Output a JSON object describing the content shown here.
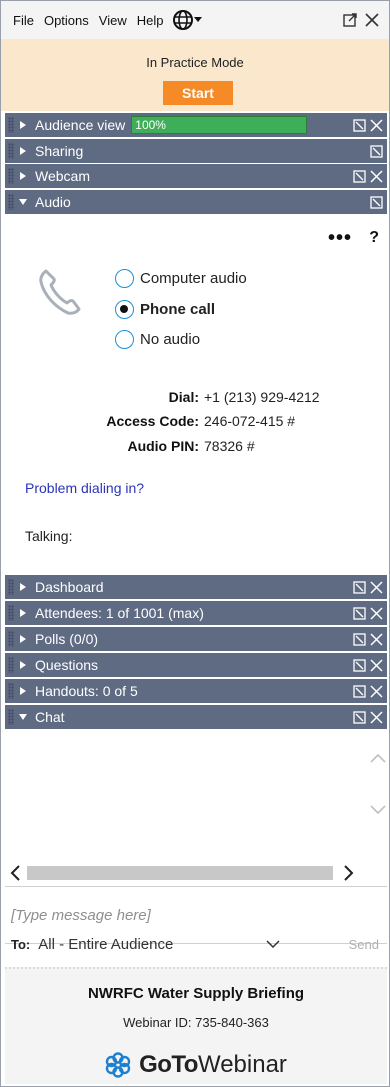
{
  "menu": {
    "items": [
      "File",
      "Options",
      "View",
      "Help"
    ],
    "globe_icon": "globe-icon",
    "popout_icon": "popout-icon",
    "close_icon": "close-icon"
  },
  "practice": {
    "mode_text": "In Practice Mode",
    "start_label": "Start",
    "accent": "#f58a26",
    "background": "#fbe8cc"
  },
  "panels": {
    "audience_view": {
      "label": "Audience view",
      "percent": "100%",
      "percent_value": 1.0
    },
    "sharing": {
      "label": "Sharing"
    },
    "webcam": {
      "label": "Webcam"
    },
    "audio": {
      "label": "Audio"
    },
    "dashboard": {
      "label": "Dashboard"
    },
    "attendees": {
      "label": "Attendees:  1 of 1001 (max)"
    },
    "polls": {
      "label": "Polls (0/0)"
    },
    "questions": {
      "label": "Questions"
    },
    "handouts": {
      "label": "Handouts: 0 of 5"
    },
    "chat": {
      "label": "Chat"
    },
    "header_color": "#5f6b83"
  },
  "audio": {
    "more_label": "•••",
    "help_label": "?",
    "options": [
      {
        "label": "Computer audio",
        "selected": false
      },
      {
        "label": "Phone call",
        "selected": true
      },
      {
        "label": "No audio",
        "selected": false
      }
    ],
    "dial": {
      "key": "Dial:",
      "value": "+1 (213) 929-4212"
    },
    "access_code": {
      "key": "Access Code:",
      "value": "246-072-415 #"
    },
    "audio_pin": {
      "key": "Audio PIN:",
      "value": "78326 #"
    },
    "problem_link": "Problem dialing in?",
    "talking": "Talking:"
  },
  "chat": {
    "placeholder": "[Type message here]",
    "to_label": "To:",
    "to_value": "All - Entire Audience",
    "send_label": "Send"
  },
  "footer": {
    "webinar_title": "NWRFC Water Supply Briefing",
    "webinar_id": "Webinar ID: 735-840-363",
    "brand_goto": "GoTo",
    "brand_webinar": "Webinar"
  }
}
